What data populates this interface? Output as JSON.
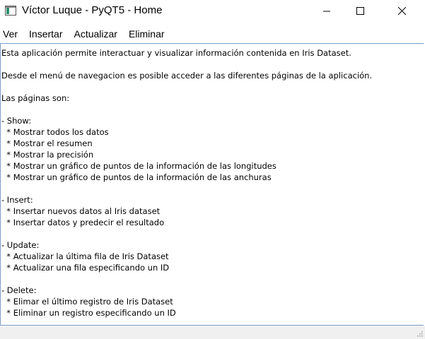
{
  "window": {
    "title": "Víctor Luque - PyQT5 - Home"
  },
  "menubar": {
    "items": [
      {
        "label": "Ver"
      },
      {
        "label": "Insertar"
      },
      {
        "label": "Actualizar"
      },
      {
        "label": "Eliminar"
      }
    ]
  },
  "content": {
    "lines": [
      "Esta aplicación permite interactuar y visualizar información contenida en Iris Dataset.",
      "",
      "Desde el menú de navegacion es posible acceder a las diferentes páginas de la aplicación.",
      "",
      "Las páginas son:",
      "",
      "- Show:",
      "  * Mostrar todos los datos",
      "  * Mostrar el resumen",
      "  * Mostrar la precisión",
      "  * Mostrar un gráfico de puntos de la información de las longitudes",
      "  * Mostrar un gráfico de puntos de la información de las anchuras",
      "",
      "- Insert:",
      "  * Insertar nuevos datos al Iris dataset",
      "  * Insertar datos y predecir el resultado",
      "",
      "- Update:",
      "  * Actualizar la última fila de Iris Dataset",
      "  * Actualizar una fila especificando un ID",
      "",
      "- Delete:",
      "  * Elimar el último registro de Iris Dataset",
      "  * Eliminar un registro especificando un ID"
    ]
  },
  "icons": {
    "app": "app-window-icon",
    "minimize": "minimize-icon",
    "maximize": "maximize-icon",
    "close": "close-icon",
    "grip": "size-grip-icon"
  },
  "colors": {
    "text_area_border": "#7a9ec9",
    "status_bar": "#f0f0f0"
  }
}
